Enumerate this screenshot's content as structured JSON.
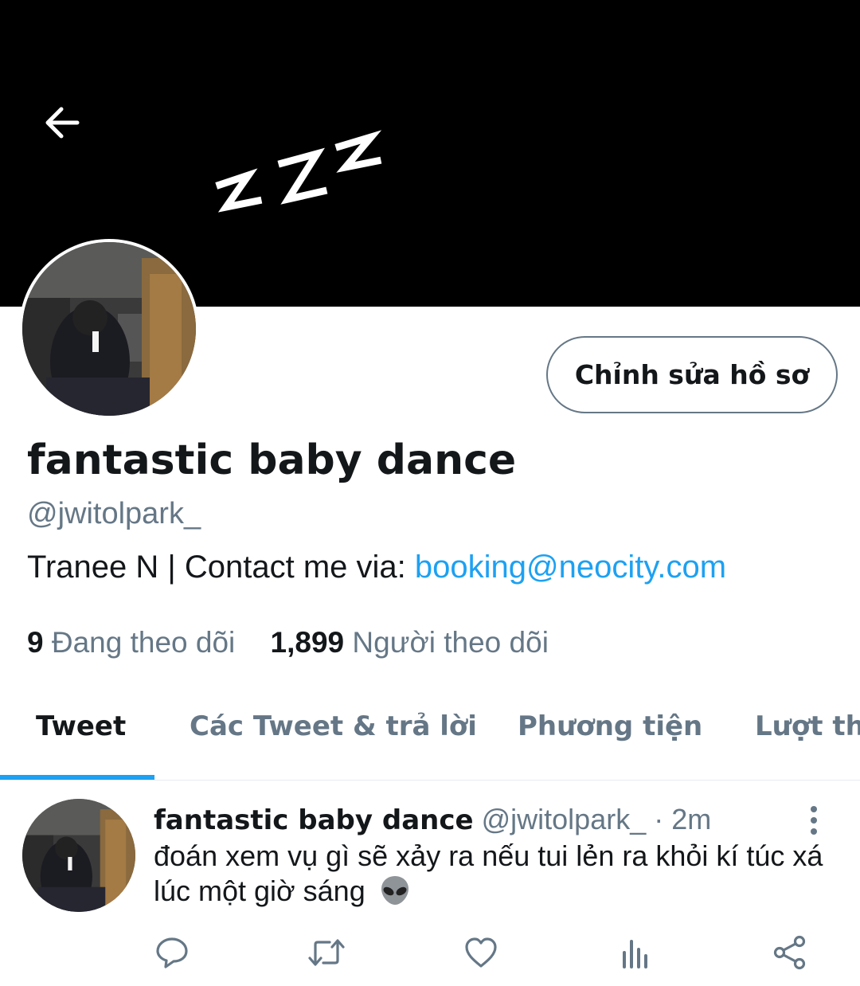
{
  "profile": {
    "display_name": "fantastic baby dance",
    "handle": "@jwitolpark_",
    "bio_text": "Tranee N | Contact me via: ",
    "bio_link": "booking@neocity.com",
    "edit_button_label": "Chỉnh sửa hồ sơ",
    "following_count": "9",
    "following_label": "Đang theo dõi",
    "followers_count": "1,899",
    "followers_label": "Người theo dõi"
  },
  "tabs": [
    {
      "label": "Tweet",
      "active": true
    },
    {
      "label": "Các Tweet & trả lời",
      "active": false
    },
    {
      "label": "Phương tiện",
      "active": false
    },
    {
      "label": "Lượt thích",
      "active": false
    }
  ],
  "tweet": {
    "author_name": "fantastic baby dance",
    "author_handle": "@jwitolpark_",
    "separator": " · ",
    "time": "2m",
    "text": "đoán xem vụ gì sẽ xảy ra nếu tui lẻn ra khỏi kí túc xá lúc một giờ sáng",
    "emoji": "alien-icon"
  },
  "icons": {
    "back": "back-arrow-icon",
    "reply": "reply-icon",
    "retweet": "retweet-icon",
    "like": "heart-icon",
    "analytics": "analytics-icon",
    "share": "share-icon",
    "more": "more-vertical-icon"
  },
  "colors": {
    "accent": "#1da1f2",
    "secondary_text": "#657786",
    "primary_text": "#14171a",
    "banner": "#000000"
  }
}
